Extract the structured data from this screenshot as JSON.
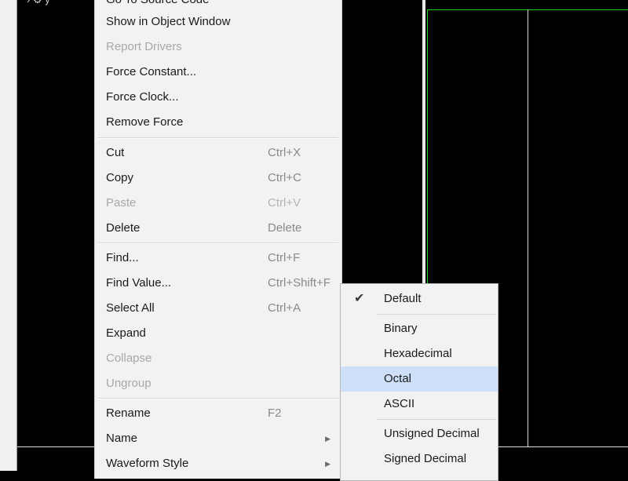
{
  "top_label": "y",
  "menu": {
    "items": [
      {
        "label": "Go To Source Code",
        "shortcut": "",
        "disabled": false
      },
      {
        "label": "Show in Object Window",
        "shortcut": "",
        "disabled": false
      },
      {
        "label": "Report Drivers",
        "shortcut": "",
        "disabled": true
      },
      {
        "label": "Force Constant...",
        "shortcut": "",
        "disabled": false
      },
      {
        "label": "Force Clock...",
        "shortcut": "",
        "disabled": false
      },
      {
        "label": "Remove Force",
        "shortcut": "",
        "disabled": false
      },
      {
        "label": "Cut",
        "shortcut": "Ctrl+X",
        "disabled": false
      },
      {
        "label": "Copy",
        "shortcut": "Ctrl+C",
        "disabled": false
      },
      {
        "label": "Paste",
        "shortcut": "Ctrl+V",
        "disabled": true
      },
      {
        "label": "Delete",
        "shortcut": "Delete",
        "disabled": false
      },
      {
        "label": "Find...",
        "shortcut": "Ctrl+F",
        "disabled": false
      },
      {
        "label": "Find Value...",
        "shortcut": "Ctrl+Shift+F",
        "disabled": false
      },
      {
        "label": "Select All",
        "shortcut": "Ctrl+A",
        "disabled": false
      },
      {
        "label": "Expand",
        "shortcut": "",
        "disabled": false
      },
      {
        "label": "Collapse",
        "shortcut": "",
        "disabled": true
      },
      {
        "label": "Ungroup",
        "shortcut": "",
        "disabled": true
      },
      {
        "label": "Rename",
        "shortcut": "F2",
        "disabled": false
      },
      {
        "label": "Name",
        "shortcut": "",
        "disabled": false
      },
      {
        "label": "Waveform Style",
        "shortcut": "",
        "disabled": false
      }
    ]
  },
  "submenu": {
    "items": [
      {
        "label": "Default",
        "checked": true,
        "selected": false
      },
      {
        "label": "Binary",
        "checked": false,
        "selected": false
      },
      {
        "label": "Hexadecimal",
        "checked": false,
        "selected": false
      },
      {
        "label": "Octal",
        "checked": false,
        "selected": true
      },
      {
        "label": "ASCII",
        "checked": false,
        "selected": false
      },
      {
        "label": "Unsigned Decimal",
        "checked": false,
        "selected": false
      },
      {
        "label": "Signed Decimal",
        "checked": false,
        "selected": false
      }
    ]
  },
  "colors": {
    "waveform_background": "#000000",
    "signal_green": "#22d322",
    "menu_background": "#f2f2f2",
    "selection_highlight": "#cde0f7"
  },
  "icons": {
    "checked": "check-icon",
    "submenu": "chevron-right-icon",
    "gear": "gear-icon"
  }
}
